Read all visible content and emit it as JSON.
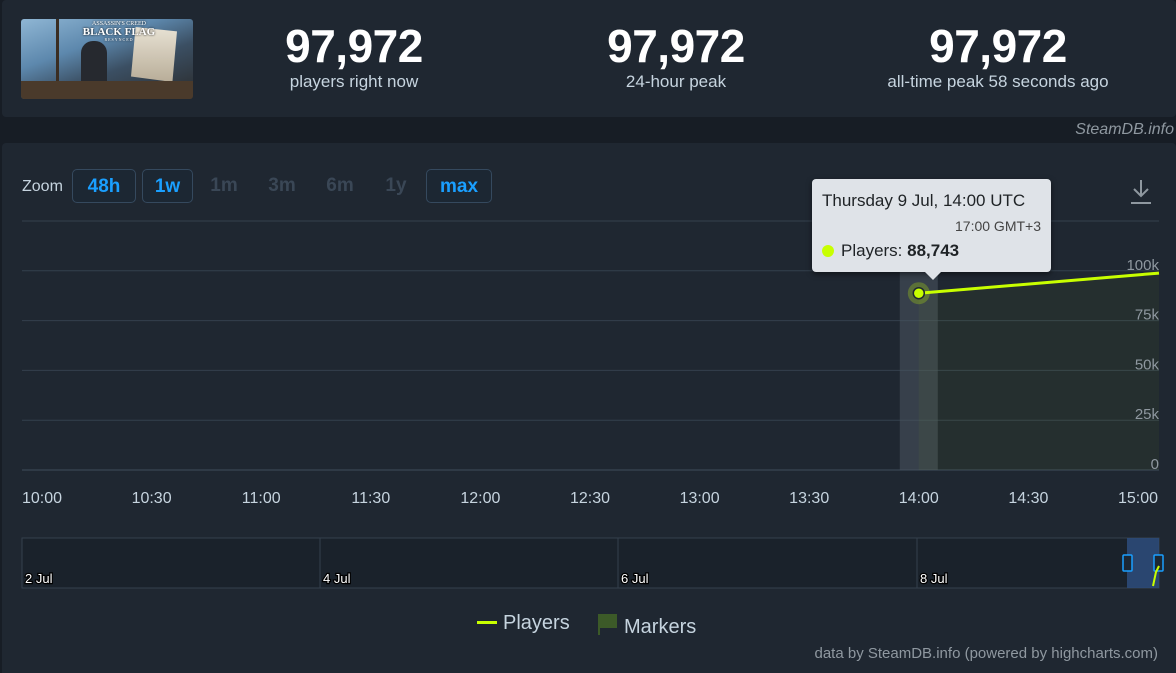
{
  "game": {
    "thumb_title_top": "ASSASSIN'S CREED",
    "thumb_title": "BLACK FLAG",
    "thumb_subtitle": "RESYNCED"
  },
  "stats": [
    {
      "value": "97,972",
      "label": "players right now"
    },
    {
      "value": "97,972",
      "label": "24-hour peak"
    },
    {
      "value": "97,972",
      "label": "all-time peak 58 seconds ago"
    }
  ],
  "watermark": "SteamDB.info",
  "zoom": {
    "label": "Zoom",
    "buttons": [
      {
        "label": "48h",
        "active": true
      },
      {
        "label": "1w",
        "active": true
      },
      {
        "label": "1m",
        "active": false
      },
      {
        "label": "3m",
        "active": false
      },
      {
        "label": "6m",
        "active": false
      },
      {
        "label": "1y",
        "active": false
      },
      {
        "label": "max",
        "active": true
      }
    ]
  },
  "tooltip": {
    "date": "Thursday 9 Jul, 14:00 UTC",
    "local_time": "17:00 GMT+3",
    "series_label": "Players: ",
    "series_value": "88,743"
  },
  "legend": {
    "players": "Players",
    "markers": "Markers"
  },
  "credits": "data by SteamDB.info (powered by highcharts.com)",
  "colors": {
    "players_line": "#c8ff00",
    "grid": "#34404d",
    "accent": "#1a9fff",
    "marker": "#3c5a28",
    "navigator_select": "#2c4a78"
  },
  "chart_data": {
    "type": "line",
    "series": [
      {
        "name": "Players",
        "x": [
          "14:00",
          "15:00"
        ],
        "values": [
          88743,
          97972
        ]
      }
    ],
    "x_ticks": [
      "10:00",
      "10:30",
      "11:00",
      "11:30",
      "12:00",
      "12:30",
      "13:00",
      "13:30",
      "14:00",
      "14:30",
      "15:00"
    ],
    "y_ticks": [
      "0",
      "25k",
      "50k",
      "75k",
      "100k"
    ],
    "ylim": [
      0,
      125000
    ],
    "grid": true,
    "hover": {
      "x": "14:00",
      "value": 88743
    },
    "navigator_labels": [
      "2 Jul",
      "4 Jul",
      "6 Jul",
      "8 Jul"
    ]
  }
}
